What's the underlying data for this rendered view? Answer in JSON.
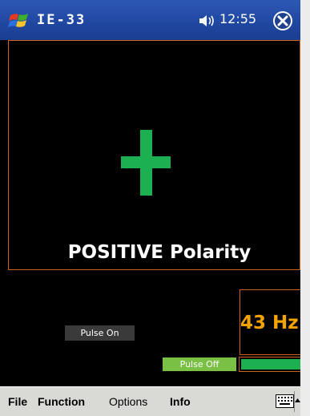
{
  "titlebar": {
    "app_title": "IE-33",
    "time": "12:55",
    "icons": [
      "windows-start-icon",
      "speaker-icon",
      "close-icon"
    ]
  },
  "display": {
    "polarity_symbol": "+",
    "polarity_label": "POSITIVE Polarity",
    "frequency": "43 Hz",
    "pulse_on_label": "Pulse On",
    "pulse_off_label": "Pulse Off"
  },
  "menubar": {
    "items": [
      {
        "label": "File"
      },
      {
        "label": "Function"
      },
      {
        "label": "Options"
      },
      {
        "label": "Info"
      }
    ],
    "icons": [
      "keyboard-icon",
      "sip-arrow-up-icon"
    ]
  },
  "colors": {
    "titlebar_blue": "#1f47a0",
    "display_bg": "#000000",
    "panel_border": "#c8621e",
    "plus_green": "#1db051",
    "frequency_orange": "#f5a300",
    "pulse_off_green": "#7ac044",
    "menubar_gray": "#d9d9d6"
  }
}
